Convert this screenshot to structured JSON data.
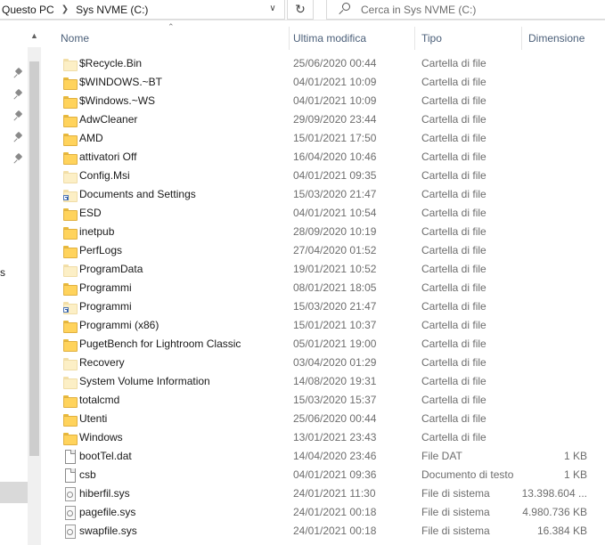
{
  "address": {
    "crumbs": [
      "Questo PC",
      "Sys NVME (C:)"
    ],
    "search_placeholder": "Cerca in Sys NVME (C:)"
  },
  "nav": {
    "partial_label": "s"
  },
  "columns": {
    "name": "Nome",
    "date": "Ultima modifica",
    "type": "Tipo",
    "size": "Dimensione"
  },
  "files": [
    {
      "name": "$Recycle.Bin",
      "date": "25/06/2020 00:44",
      "type": "Cartella di file",
      "size": "",
      "icon": "folder-pale-icon"
    },
    {
      "name": "$WINDOWS.~BT",
      "date": "04/01/2021 10:09",
      "type": "Cartella di file",
      "size": "",
      "icon": "folder-icon"
    },
    {
      "name": "$Windows.~WS",
      "date": "04/01/2021 10:09",
      "type": "Cartella di file",
      "size": "",
      "icon": "folder-icon"
    },
    {
      "name": "AdwCleaner",
      "date": "29/09/2020 23:44",
      "type": "Cartella di file",
      "size": "",
      "icon": "folder-icon"
    },
    {
      "name": "AMD",
      "date": "15/01/2021 17:50",
      "type": "Cartella di file",
      "size": "",
      "icon": "folder-icon"
    },
    {
      "name": "attivatori Off",
      "date": "16/04/2020 10:46",
      "type": "Cartella di file",
      "size": "",
      "icon": "folder-icon"
    },
    {
      "name": "Config.Msi",
      "date": "04/01/2021 09:35",
      "type": "Cartella di file",
      "size": "",
      "icon": "folder-pale-icon"
    },
    {
      "name": "Documents and Settings",
      "date": "15/03/2020 21:47",
      "type": "Cartella di file",
      "size": "",
      "icon": "shortcut-folder-icon"
    },
    {
      "name": "ESD",
      "date": "04/01/2021 10:54",
      "type": "Cartella di file",
      "size": "",
      "icon": "folder-icon"
    },
    {
      "name": "inetpub",
      "date": "28/09/2020 10:19",
      "type": "Cartella di file",
      "size": "",
      "icon": "folder-icon"
    },
    {
      "name": "PerfLogs",
      "date": "27/04/2020 01:52",
      "type": "Cartella di file",
      "size": "",
      "icon": "folder-icon"
    },
    {
      "name": "ProgramData",
      "date": "19/01/2021 10:52",
      "type": "Cartella di file",
      "size": "",
      "icon": "folder-pale-icon"
    },
    {
      "name": "Programmi",
      "date": "08/01/2021 18:05",
      "type": "Cartella di file",
      "size": "",
      "icon": "folder-icon"
    },
    {
      "name": "Programmi",
      "date": "15/03/2020 21:47",
      "type": "Cartella di file",
      "size": "",
      "icon": "shortcut-folder-icon"
    },
    {
      "name": "Programmi (x86)",
      "date": "15/01/2021 10:37",
      "type": "Cartella di file",
      "size": "",
      "icon": "folder-icon"
    },
    {
      "name": "PugetBench for Lightroom Classic",
      "date": "05/01/2021 19:00",
      "type": "Cartella di file",
      "size": "",
      "icon": "folder-icon"
    },
    {
      "name": "Recovery",
      "date": "03/04/2020 01:29",
      "type": "Cartella di file",
      "size": "",
      "icon": "folder-pale-icon"
    },
    {
      "name": "System Volume Information",
      "date": "14/08/2020 19:31",
      "type": "Cartella di file",
      "size": "",
      "icon": "folder-pale-icon"
    },
    {
      "name": "totalcmd",
      "date": "15/03/2020 15:37",
      "type": "Cartella di file",
      "size": "",
      "icon": "folder-icon"
    },
    {
      "name": "Utenti",
      "date": "25/06/2020 00:44",
      "type": "Cartella di file",
      "size": "",
      "icon": "folder-icon"
    },
    {
      "name": "Windows",
      "date": "13/01/2021 23:43",
      "type": "Cartella di file",
      "size": "",
      "icon": "folder-icon"
    },
    {
      "name": "bootTel.dat",
      "date": "14/04/2020 23:46",
      "type": "File DAT",
      "size": "1 KB",
      "icon": "file-icon"
    },
    {
      "name": "csb",
      "date": "04/01/2021 09:36",
      "type": "Documento di testo",
      "size": "1 KB",
      "icon": "file-icon"
    },
    {
      "name": "hiberfil.sys",
      "date": "24/01/2021 11:30",
      "type": "File di sistema",
      "size": "13.398.604 ...",
      "icon": "system-file-icon"
    },
    {
      "name": "pagefile.sys",
      "date": "24/01/2021 00:18",
      "type": "File di sistema",
      "size": "4.980.736 KB",
      "icon": "system-file-icon"
    },
    {
      "name": "swapfile.sys",
      "date": "24/01/2021 00:18",
      "type": "File di sistema",
      "size": "16.384 KB",
      "icon": "system-file-icon"
    }
  ]
}
